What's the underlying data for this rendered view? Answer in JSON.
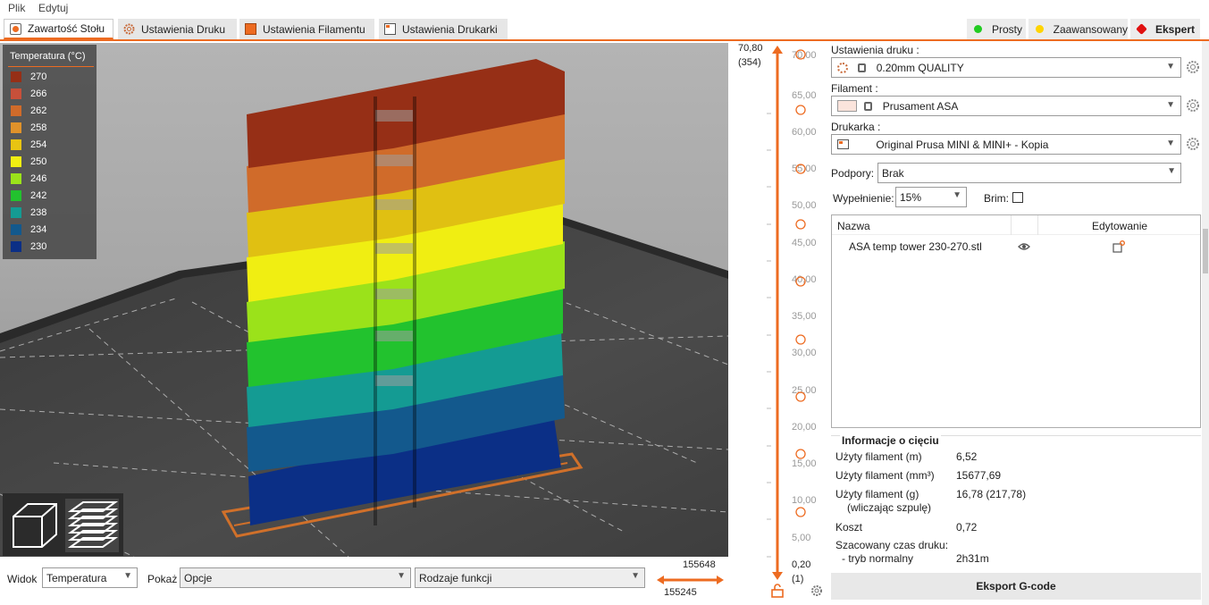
{
  "menu": {
    "file": "Plik",
    "edit": "Edytuj"
  },
  "tabs": [
    {
      "label": "Zawartość Stołu",
      "icon": "plater-icon",
      "active": true
    },
    {
      "label": "Ustawienia Druku",
      "icon": "print-settings-icon"
    },
    {
      "label": "Ustawienia Filamentu",
      "icon": "filament-spool-icon"
    },
    {
      "label": "Ustawienia Drukarki",
      "icon": "printer-settings-icon"
    }
  ],
  "modes": [
    {
      "label": "Prosty",
      "color": "#22cc22"
    },
    {
      "label": "Zaawansowany",
      "color": "#ffd400"
    },
    {
      "label": "Ekspert",
      "color": "#e01010"
    }
  ],
  "legend": {
    "title": "Temperatura (°C)",
    "items": [
      {
        "value": "270",
        "color": "#962f16"
      },
      {
        "value": "266",
        "color": "#c8503a"
      },
      {
        "value": "262",
        "color": "#d06b2a"
      },
      {
        "value": "258",
        "color": "#e0922a"
      },
      {
        "value": "254",
        "color": "#e8c412"
      },
      {
        "value": "250",
        "color": "#f0ee12"
      },
      {
        "value": "246",
        "color": "#9be21a"
      },
      {
        "value": "242",
        "color": "#22c22e"
      },
      {
        "value": "238",
        "color": "#149b93"
      },
      {
        "value": "234",
        "color": "#13598d"
      },
      {
        "value": "230",
        "color": "#0b2f86"
      }
    ]
  },
  "bottom": {
    "view_label": "Widok",
    "view_value": "Temperatura",
    "show_label": "Pokaż",
    "show_value": "Opcje",
    "features_value": "Rodzaje funkcji",
    "hslider_top": "155648",
    "hslider_bottom": "155245"
  },
  "vslider": {
    "top_value": "70,80",
    "top_layer": "(354)",
    "bottom_value": "0,20",
    "bottom_layer": "(1)",
    "ticks": [
      "70,00",
      "65,00",
      "60,00",
      "55,00",
      "50,00",
      "45,00",
      "40,00",
      "35,00",
      "30,00",
      "25,00",
      "20,00",
      "15,00",
      "10,00",
      "5,00"
    ]
  },
  "panel": {
    "print_settings_label": "Ustawienia druku :",
    "print_settings_value": "0.20mm QUALITY",
    "filament_label": "Filament :",
    "filament_value": "Prusament ASA",
    "filament_color": "#fbe4dc",
    "printer_label": "Drukarka :",
    "printer_value": "Original Prusa MINI & MINI+ - Kopia",
    "supports_label": "Podpory:",
    "supports_value": "Brak",
    "infill_label": "Wypełnienie:",
    "infill_value": "15%",
    "brim_label": "Brim:",
    "objects": {
      "col_name": "Nazwa",
      "col_edit": "Edytowanie",
      "rows": [
        {
          "name": "ASA temp tower 230-270.stl"
        }
      ]
    },
    "info": {
      "title": "Informacje o cięciu",
      "rows": [
        {
          "key": "Użyty filament (m)",
          "value": "6,52"
        },
        {
          "key": "Użyty filament (mm³)",
          "value": "15677,69"
        },
        {
          "key": "Użyty filament (g)",
          "key2": "(wliczając szpulę)",
          "value": "16,78 (217,78)"
        },
        {
          "key": "Koszt",
          "value": "0,72"
        },
        {
          "key": "Szacowany czas druku:",
          "key2": "- tryb normalny",
          "value": "2h31m"
        }
      ]
    },
    "export_label": "Eksport G-code"
  }
}
